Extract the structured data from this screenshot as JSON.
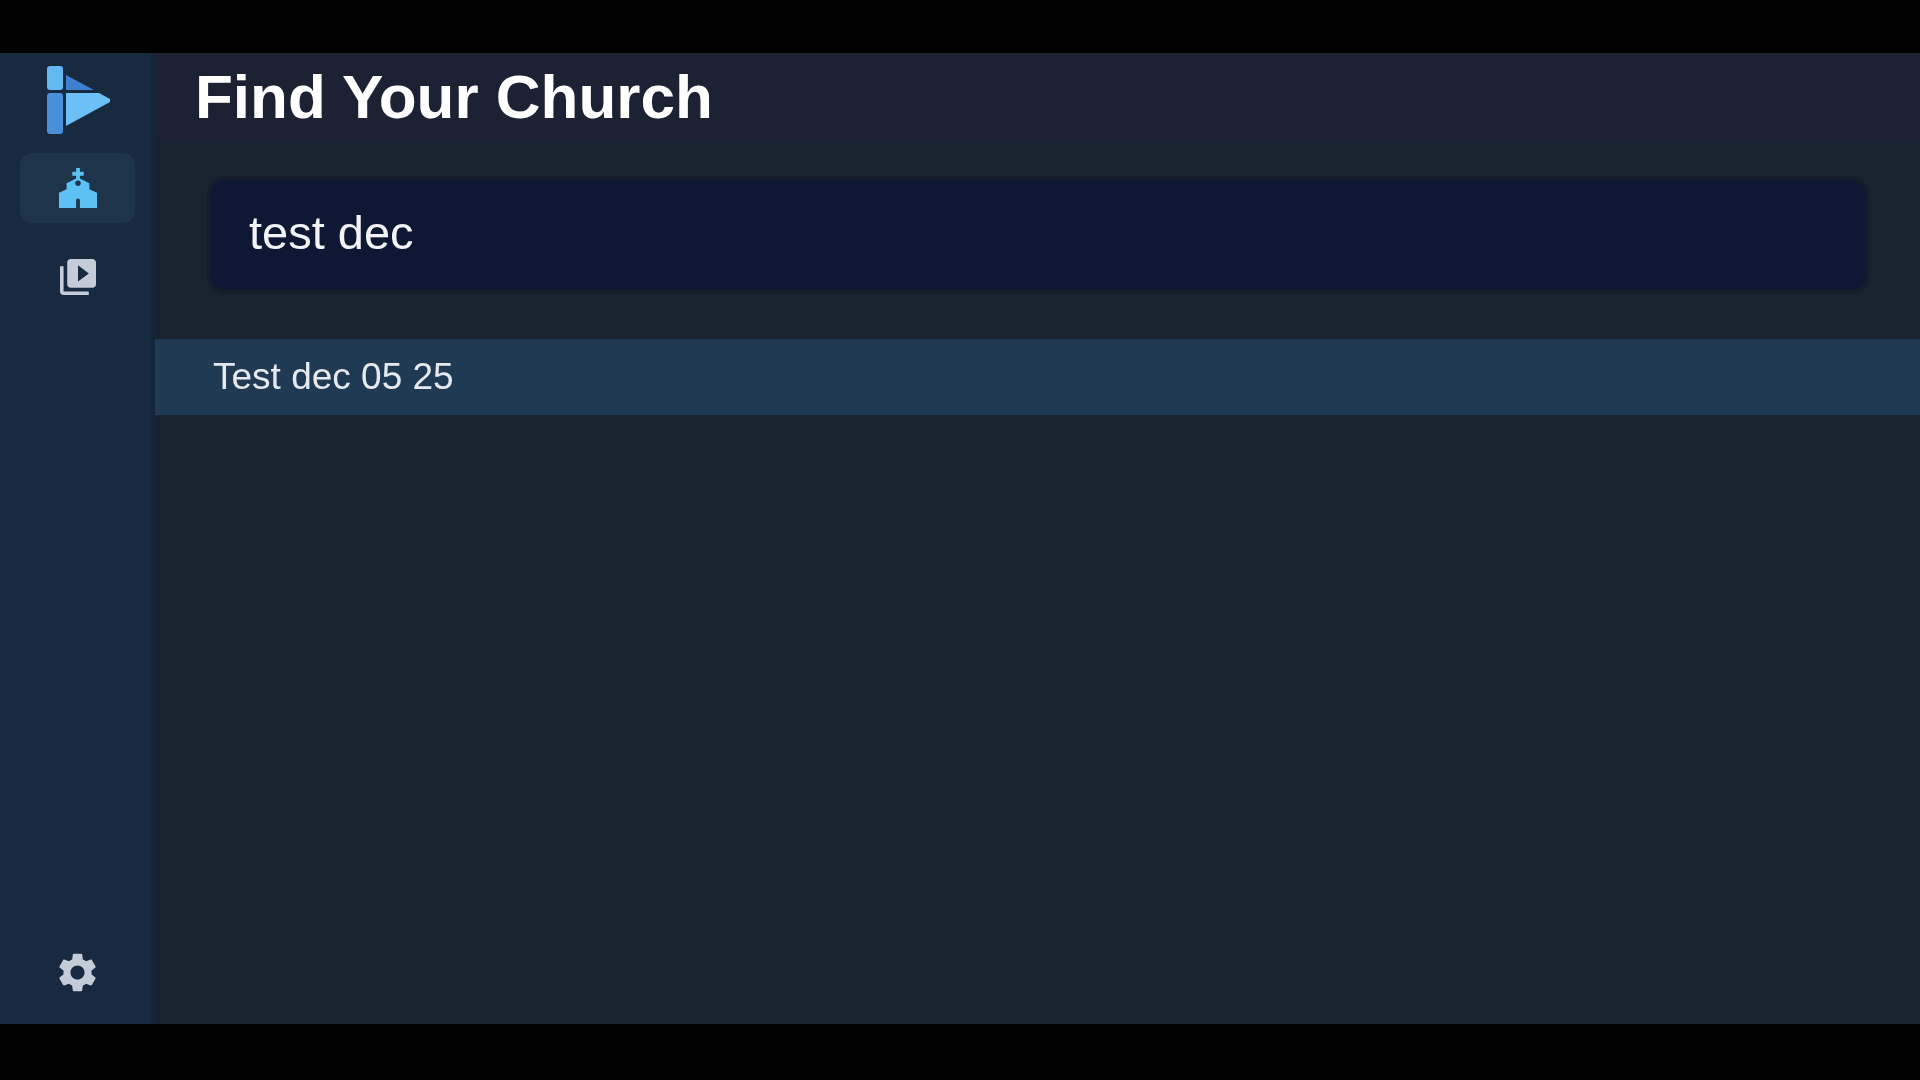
{
  "sidebar": {
    "items": [
      {
        "kind": "church",
        "selected": true
      },
      {
        "kind": "videos",
        "selected": false
      },
      {
        "kind": "settings",
        "selected": false
      }
    ]
  },
  "header": {
    "title": "Find Your Church"
  },
  "search": {
    "value": "test dec"
  },
  "results": [
    {
      "label": "Test dec 05 25",
      "selected": true
    }
  ]
}
